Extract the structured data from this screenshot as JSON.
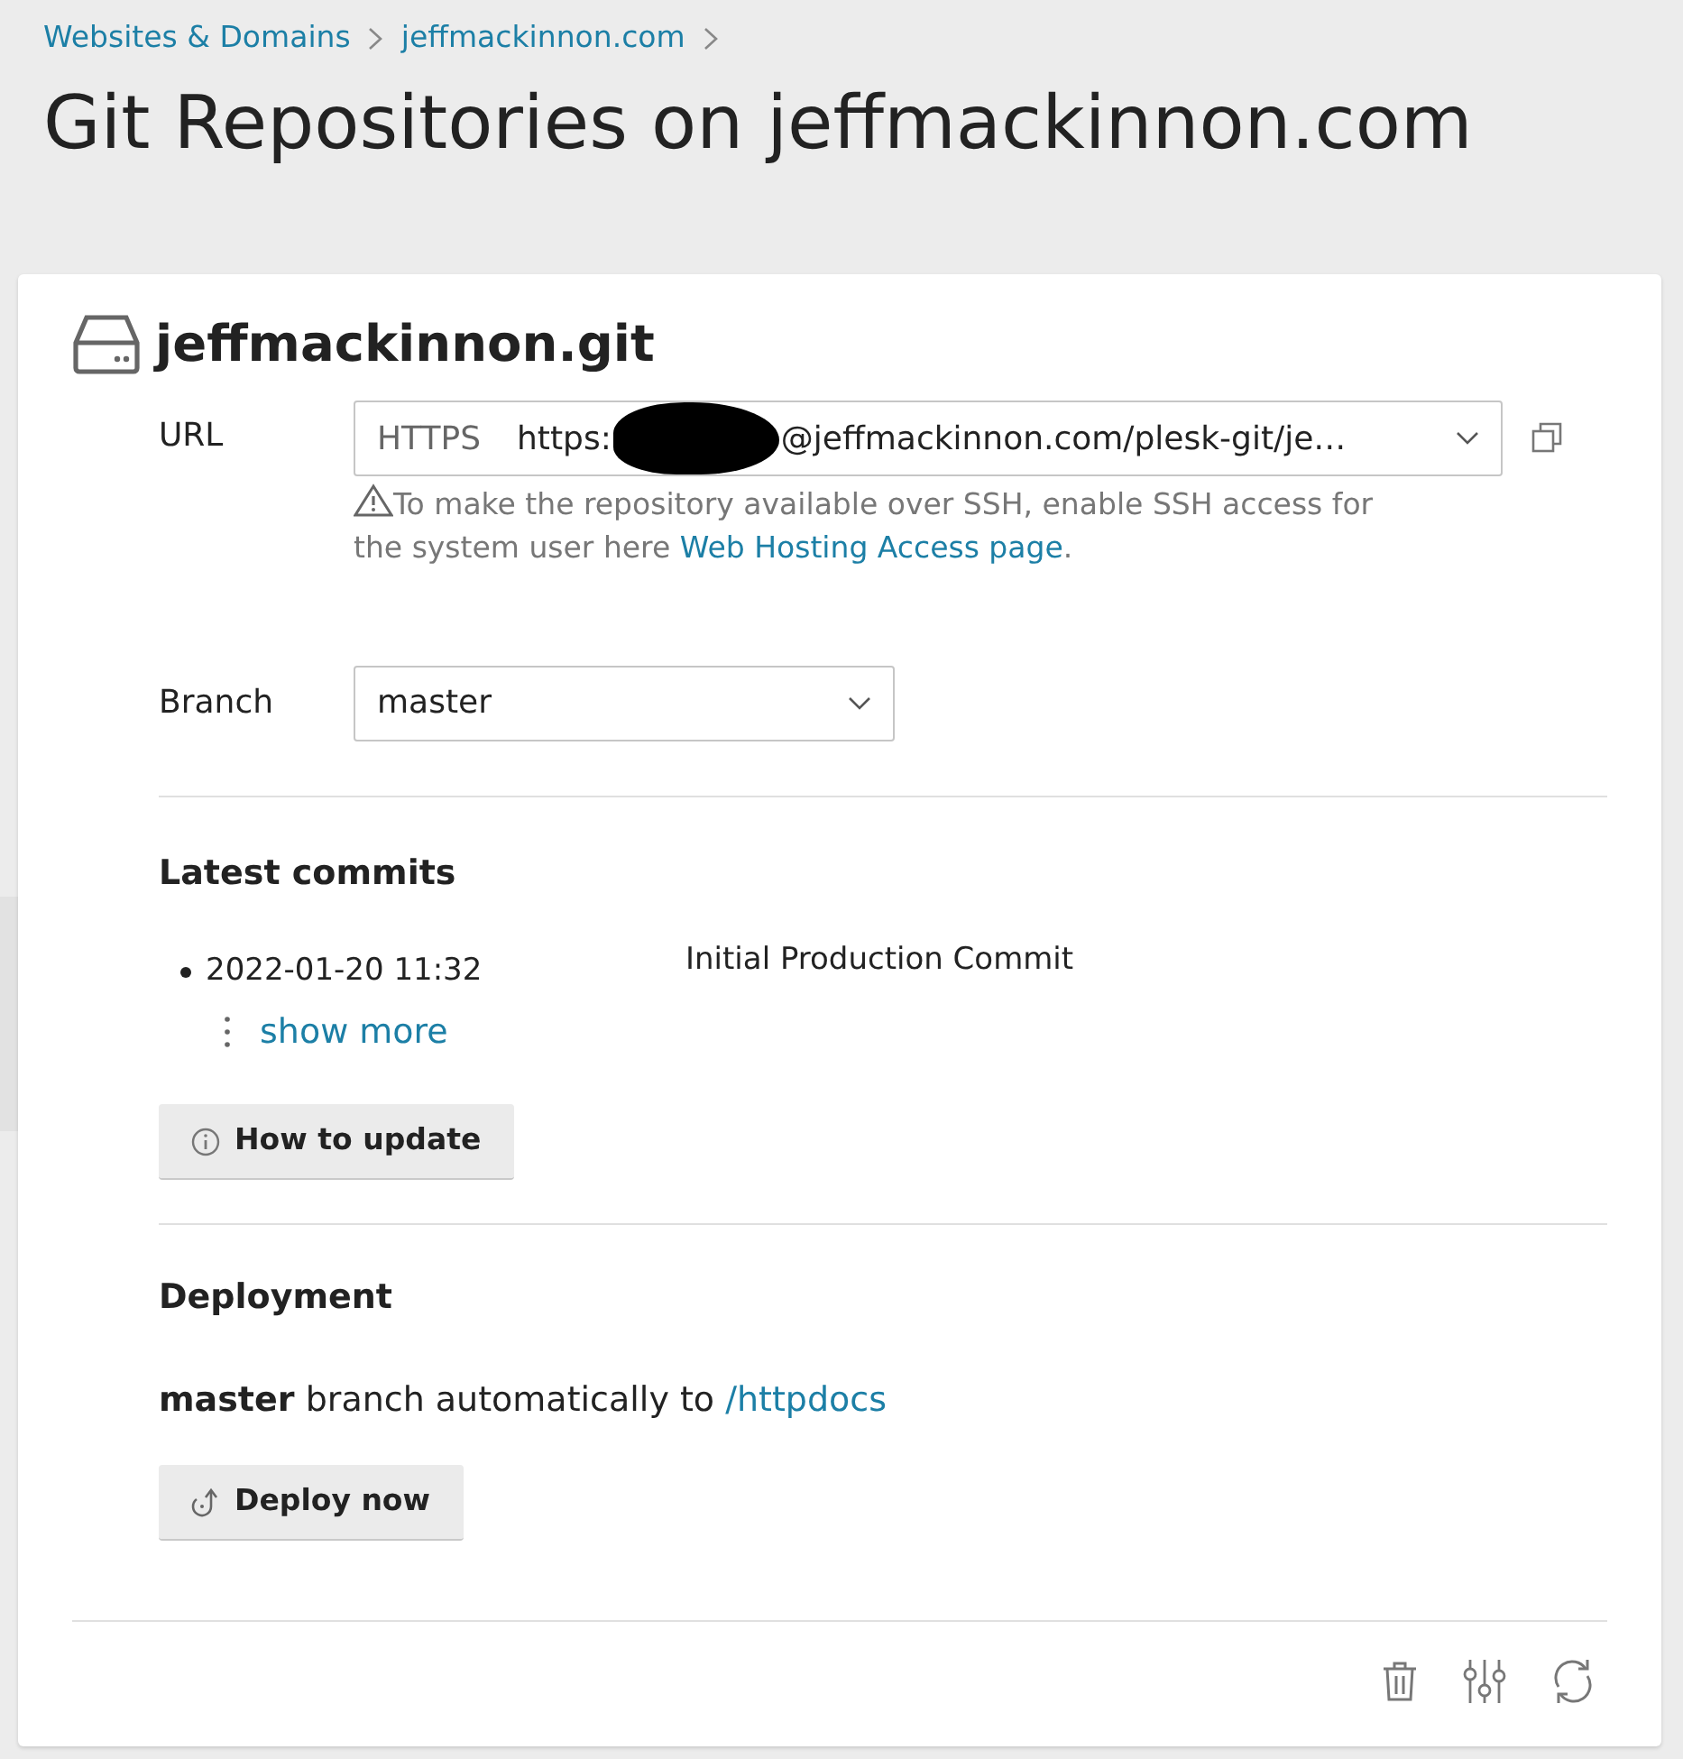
{
  "breadcrumbs": [
    {
      "label": "Websites & Domains"
    },
    {
      "label": "jeffmackinnon.com"
    }
  ],
  "page_title": "Git Repositories on jeffmackinnon.com",
  "repository": {
    "name": "jeffmackinnon.git",
    "url": {
      "label": "URL",
      "protocol": "HTTPS",
      "value_start": "https:",
      "value_end": "@jeffmackinnon.com/plesk-git/je…",
      "redacted": true
    },
    "ssh_note": {
      "text": "To make the repository available over SSH, enable SSH access for the system user here ",
      "link": "Web Hosting Access page",
      "end": "."
    },
    "branch": {
      "label": "Branch",
      "value": "master"
    },
    "latest_commits": {
      "heading": "Latest commits",
      "commits": [
        {
          "date": "2022-01-20 11:32",
          "message": "Initial Production Commit"
        }
      ],
      "show_more": "show more",
      "button": "How to update"
    },
    "deployment": {
      "heading": "Deployment",
      "text": "**master** branch automatically to ",
      "path": "/httpdocs",
      "button": "Deploy now"
    }
  }
}
